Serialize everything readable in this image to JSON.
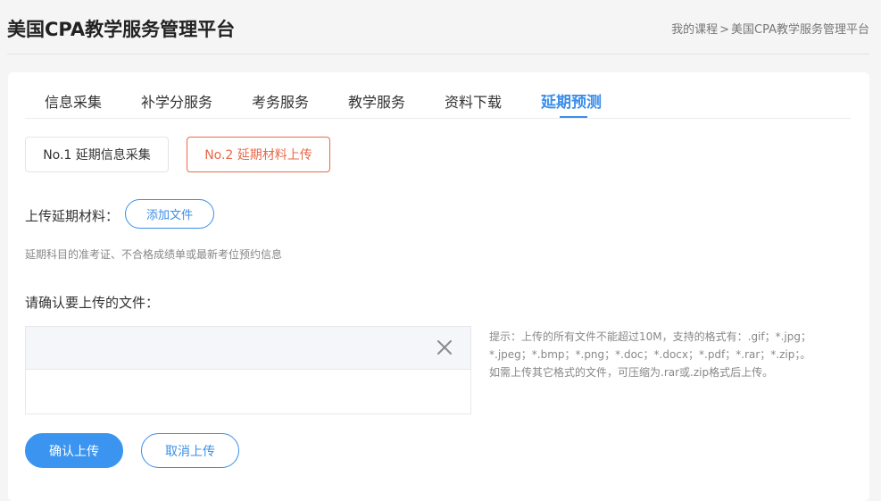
{
  "header": {
    "title": "美国CPA教学服务管理平台",
    "breadcrumb": {
      "link": "我的课程",
      "separator": ">",
      "current": "美国CPA教学服务管理平台"
    }
  },
  "tabs": [
    {
      "label": "信息采集"
    },
    {
      "label": "补学分服务"
    },
    {
      "label": "考务服务"
    },
    {
      "label": "教学服务"
    },
    {
      "label": "资料下载"
    },
    {
      "label": "延期预测",
      "active": true
    }
  ],
  "steps": {
    "step1": "No.1 延期信息采集",
    "step2": "No.2 延期材料上传",
    "active": "step2"
  },
  "upload": {
    "label": "上传延期材料：",
    "add_file": "添加文件",
    "hint": "延期科目的准考证、不合格成绩单或最新考位预约信息",
    "confirm_title": "请确认要上传的文件：",
    "tip": "提示：上传的所有文件不能超过10M，支持的格式有：.gif；*.jpg；*.jpeg；*.bmp；*.png；*.doc；*.docx；*.pdf；*.rar；*.zip；。如需上传其它格式的文件，可压缩为.rar或.zip格式后上传。"
  },
  "actions": {
    "confirm": "确认上传",
    "cancel": "取消上传"
  },
  "colors": {
    "accent": "#3b8ee8",
    "active_step": "#e8694a"
  }
}
